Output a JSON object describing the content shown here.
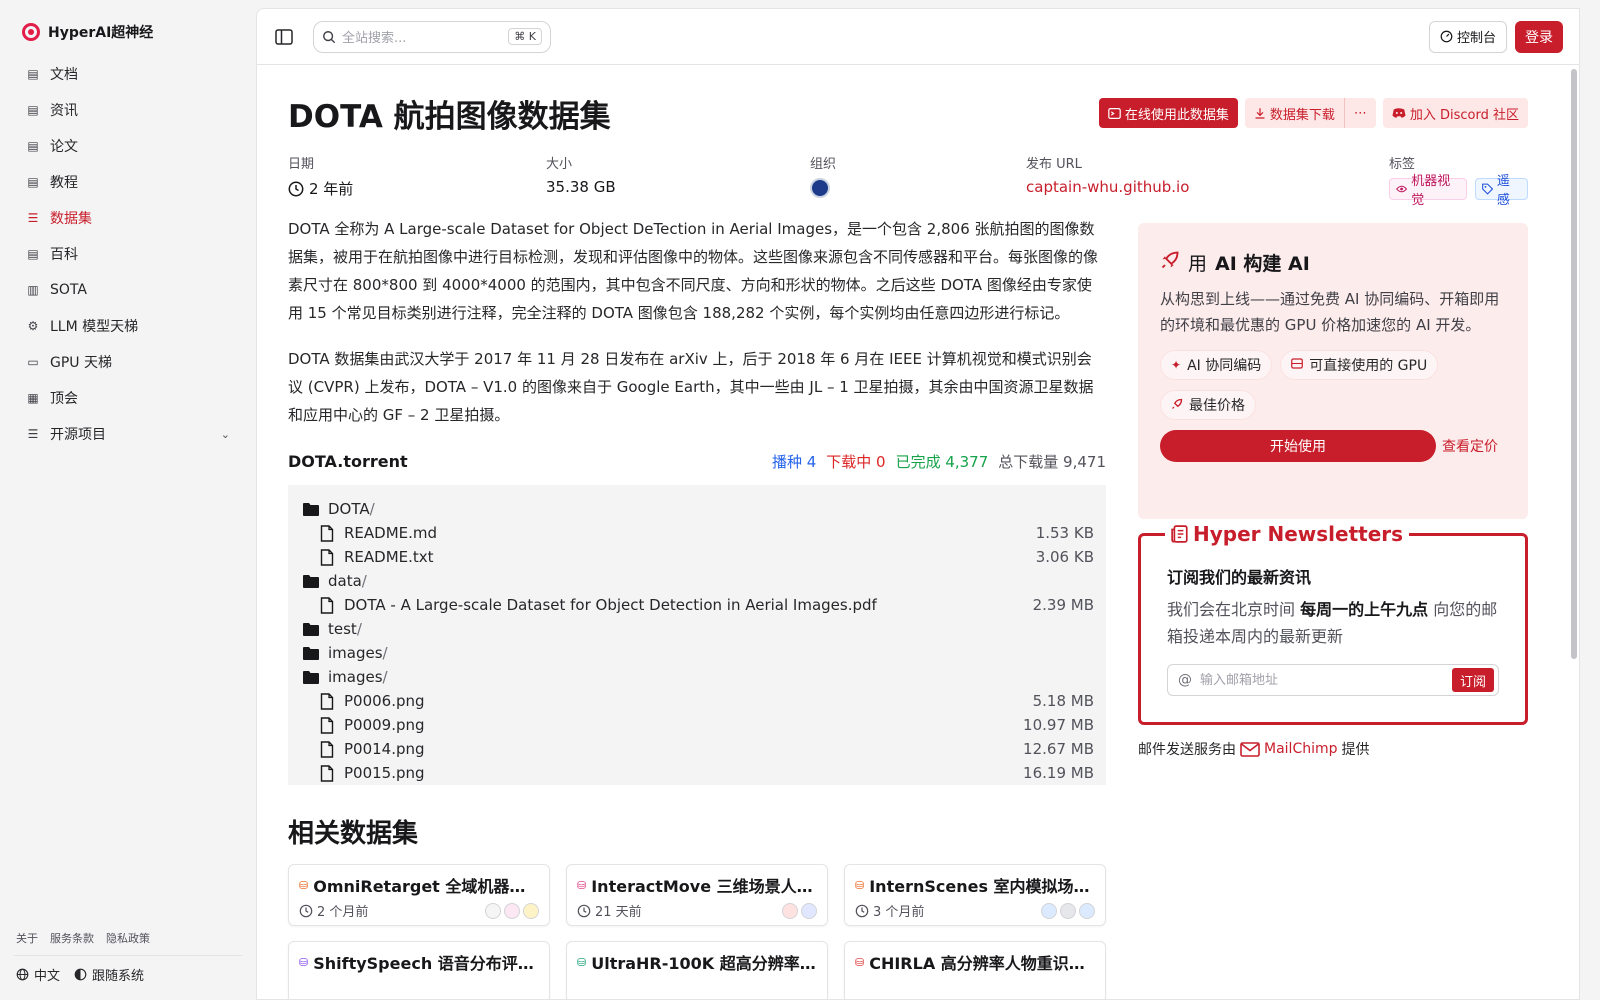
{
  "brand": {
    "name": "HyperAI超神经"
  },
  "sidebar": {
    "items": [
      {
        "label": "文档",
        "icon": "doc-icon",
        "active": false
      },
      {
        "label": "资讯",
        "icon": "news-icon",
        "active": false
      },
      {
        "label": "论文",
        "icon": "paper-icon",
        "active": false
      },
      {
        "label": "教程",
        "icon": "tutorial-icon",
        "active": false
      },
      {
        "label": "数据集",
        "icon": "database-icon",
        "active": true
      },
      {
        "label": "百科",
        "icon": "wiki-icon",
        "active": false
      },
      {
        "label": "SOTA",
        "icon": "chart-icon",
        "active": false
      },
      {
        "label": "LLM 模型天梯",
        "icon": "cpu-icon",
        "active": false
      },
      {
        "label": "GPU 天梯",
        "icon": "monitor-icon",
        "active": false
      },
      {
        "label": "顶会",
        "icon": "conference-icon",
        "active": false
      },
      {
        "label": "开源项目",
        "icon": "list-icon",
        "active": false
      }
    ],
    "footer_links": [
      "关于",
      "服务条款",
      "隐私政策"
    ],
    "language": "中文",
    "theme": "跟随系统"
  },
  "topbar": {
    "search_placeholder": "全站搜索...",
    "search_shortcut": "K",
    "console_label": "控制台",
    "login_label": "登录"
  },
  "dataset": {
    "title": "DOTA 航拍图像数据集",
    "actions": {
      "use_online": "在线使用此数据集",
      "download": "数据集下载",
      "more": "⋯",
      "discord": "加入 Discord 社区"
    },
    "meta": {
      "date_label": "日期",
      "date_value": "2 年前",
      "size_label": "大小",
      "size_value": "35.38 GB",
      "org_label": "组织",
      "url_label": "发布 URL",
      "url_value": "captain-whu.github.io",
      "tags_label": "标签",
      "tags": [
        "机器视觉",
        "遥感"
      ]
    },
    "description": [
      "DOTA 全称为 A Large-scale Dataset for Object DeTection in Aerial Images，是一个包含 2,806 张航拍图的图像数据集，被用于在航拍图像中进行目标检测，发现和评估图像中的物体。这些图像来源包含不同传感器和平台。每张图像的像素尺寸在 800*800 到 4000*4000 的范围内，其中包含不同尺度、方向和形状的物体。之后这些 DOTA 图像经由专家使用 15 个常见目标类别进行注释，完全注释的 DOTA 图像包含 188,282 个实例，每个实例均由任意四边形进行标记。",
      "DOTA 数据集由武汉大学于 2017 年 11 月 28 日发布在 arXiv 上，后于 2018 年 6 月在 IEEE 计算机视觉和模式识别会议 (CVPR) 上发布，DOTA – V1.0 的图像来自于 Google Earth，其中一些由 JL – 1 卫星拍摄，其余由中国资源卫星数据和应用中心的 GF – 2 卫星拍摄。"
    ]
  },
  "torrent": {
    "name": "DOTA.torrent",
    "seeding": "播种 4",
    "downloading": "下载中 0",
    "completed": "已完成 4,377",
    "total_downloads": "总下载量 9,471",
    "files": [
      {
        "type": "folder",
        "name": "DOTA",
        "indent": 0,
        "size": ""
      },
      {
        "type": "file",
        "name": "README.md",
        "indent": 1,
        "size": "1.53 KB"
      },
      {
        "type": "file",
        "name": "README.txt",
        "indent": 1,
        "size": "3.06 KB"
      },
      {
        "type": "folder",
        "name": "data",
        "indent": 0,
        "size": ""
      },
      {
        "type": "file",
        "name": "DOTA - A Large-scale Dataset for Object Detection in Aerial Images.pdf",
        "indent": 1,
        "size": "2.39 MB"
      },
      {
        "type": "folder",
        "name": "test",
        "indent": 0,
        "size": ""
      },
      {
        "type": "folder",
        "name": "images",
        "indent": 0,
        "size": ""
      },
      {
        "type": "folder",
        "name": "images",
        "indent": 0,
        "size": ""
      },
      {
        "type": "file",
        "name": "P0006.png",
        "indent": 1,
        "size": "5.18 MB"
      },
      {
        "type": "file",
        "name": "P0009.png",
        "indent": 1,
        "size": "10.97 MB"
      },
      {
        "type": "file",
        "name": "P0014.png",
        "indent": 1,
        "size": "12.67 MB"
      },
      {
        "type": "file",
        "name": "P0015.png",
        "indent": 1,
        "size": "16.19 MB"
      }
    ]
  },
  "related": {
    "title": "相关数据集",
    "items": [
      {
        "title": "OmniRetarget 全域机器人…",
        "time": "2 个月前",
        "icon_color": "#ea580c"
      },
      {
        "title": "InteractMove 三维场景人…",
        "time": "21 天前",
        "icon_color": "#db2777"
      },
      {
        "title": "InternScenes 室内模拟场…",
        "time": "3 个月前",
        "icon_color": "#ea580c"
      },
      {
        "title": "ShiftySpeech 语音分布评…",
        "time": "",
        "icon_color": "#7c3aed"
      },
      {
        "title": "UltraHR-100K 超高分辨率…",
        "time": "",
        "icon_color": "#059669"
      },
      {
        "title": "CHIRLA 高分辨率人物重识…",
        "time": "",
        "icon_color": "#dc2626"
      }
    ]
  },
  "ai_card": {
    "title_pre": "用",
    "title_bold": "AI 构建 AI",
    "description": "从构思到上线——通过免费 AI 协同编码、开箱即用的环境和最优惠的 GPU 价格加速您的 AI 开发。",
    "chips": [
      "AI 协同编码",
      "可直接使用的 GPU",
      "最佳价格"
    ],
    "start_label": "开始使用",
    "pricing_label": "查看定价"
  },
  "newsletter": {
    "title": "Hyper Newsletters",
    "subtitle": "订阅我们的最新资讯",
    "desc_pre": "我们会在北京时间",
    "desc_bold": "每周一的上午九点",
    "desc_post": "向您的邮箱投递本周内的最新更新",
    "email_placeholder": "输入邮箱地址",
    "subscribe_label": "订阅",
    "provider_pre": "邮件发送服务由",
    "provider_name": "MailChimp",
    "provider_post": "提供"
  },
  "colors": {
    "accent": "#c81e2b",
    "accent_soft": "#fde7e7"
  }
}
